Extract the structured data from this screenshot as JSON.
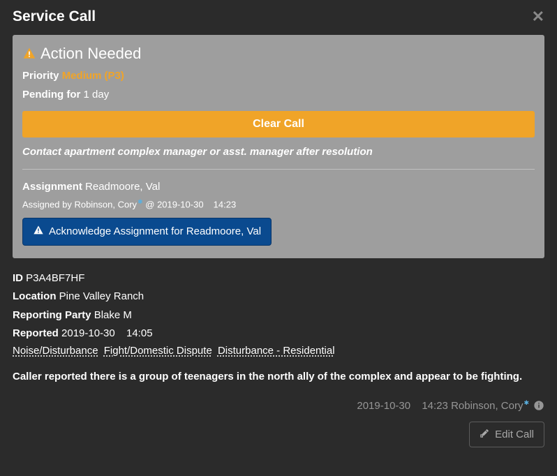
{
  "header": {
    "title": "Service Call"
  },
  "action": {
    "title": "Action Needed",
    "priority_label": "Priority",
    "priority_value": "Medium (P3)",
    "pending_label": "Pending for",
    "pending_value": "1 day",
    "clear_btn": "Clear Call",
    "note": "Contact apartment complex manager or asst. manager after resolution"
  },
  "assignment": {
    "label": "Assignment",
    "value": "Readmoore, Val",
    "by_prefix": "Assigned by",
    "by_name": "Robinson, Cory",
    "at_prefix": "@",
    "at_datetime": "2019-10-30  14:23",
    "ack_btn": "Acknowledge Assignment for Readmoore, Val"
  },
  "details": {
    "id_label": "ID",
    "id_value": "P3A4BF7HF",
    "location_label": "Location",
    "location_value": "Pine Valley Ranch",
    "reporting_label": "Reporting Party",
    "reporting_value": "Blake M",
    "reported_label": "Reported",
    "reported_value": "2019-10-30  14:05",
    "tags": [
      "Noise/Disturbance",
      "Fight/Domestic Dispute",
      "Disturbance - Residential"
    ]
  },
  "description": "Caller reported there is a group of teenagers in the north ally of the complex and appear to be fighting.",
  "footer": {
    "meta_datetime": "2019-10-30  14:23",
    "meta_name": "Robinson, Cory",
    "edit_btn": "Edit Call"
  }
}
